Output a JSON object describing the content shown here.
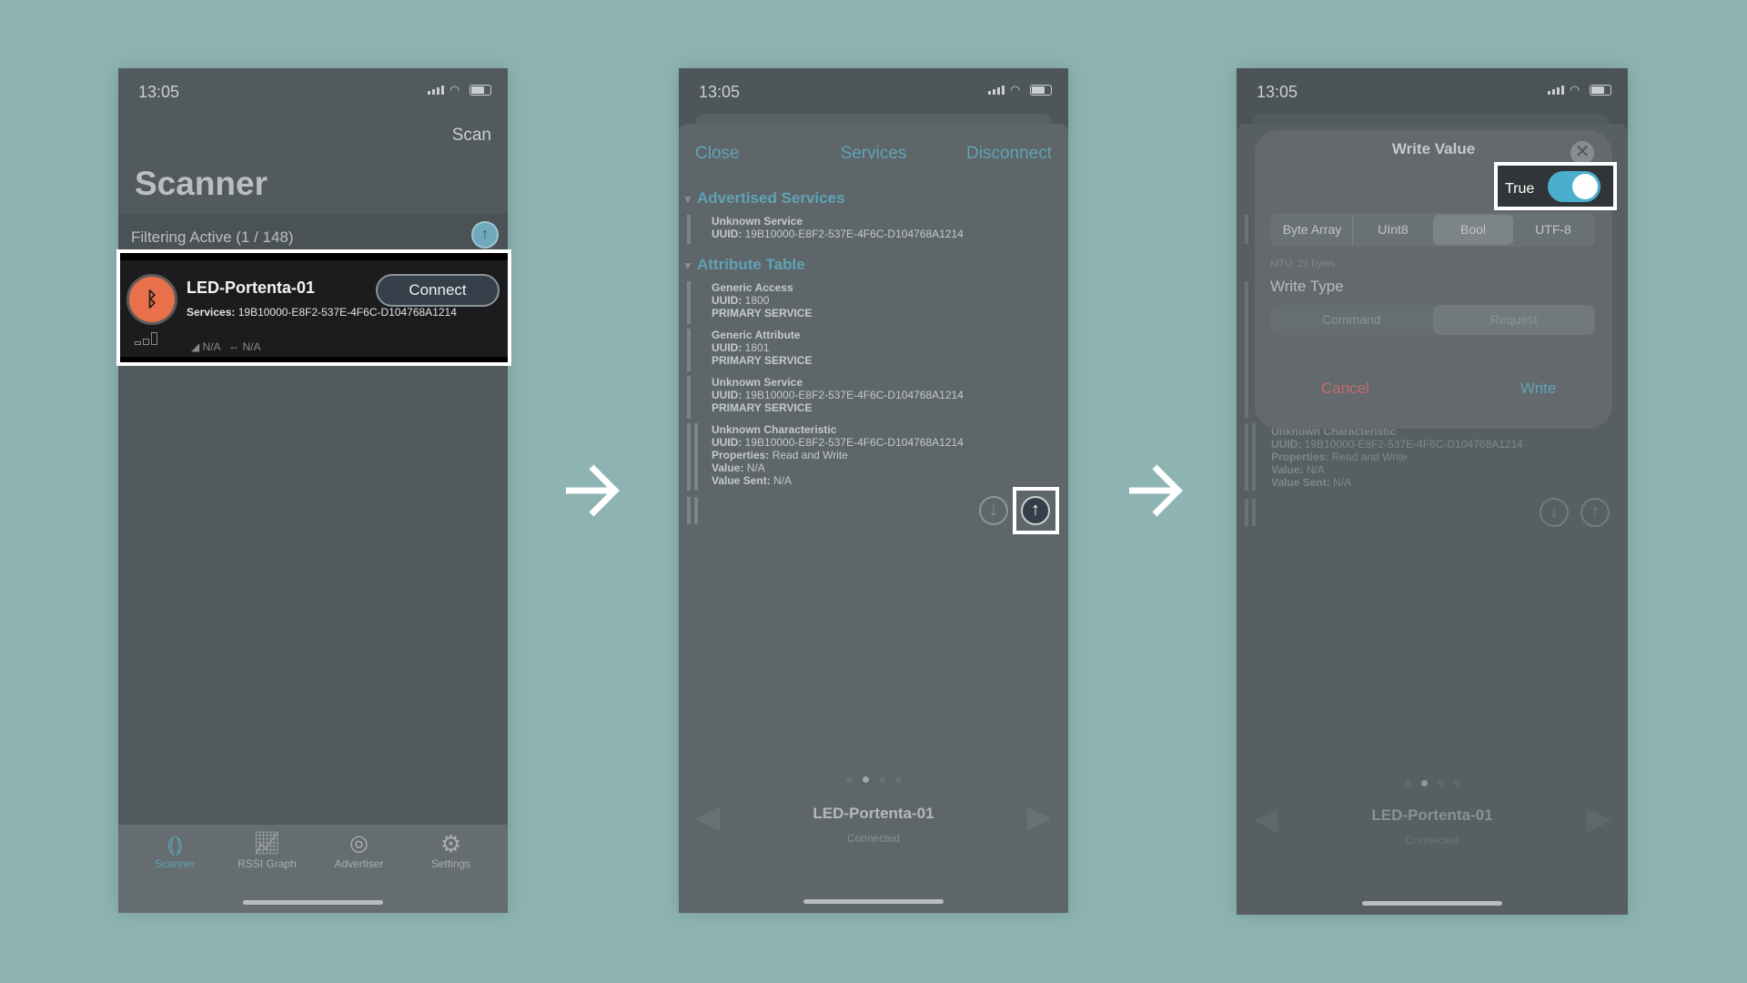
{
  "status": {
    "time": "13:05"
  },
  "screen1": {
    "nav_action": "Scan",
    "title": "Scanner",
    "filter_text": "Filtering Active (1 / 148)",
    "device": {
      "name": "LED-Portenta-01",
      "connect_label": "Connect",
      "services_label": "Services:",
      "services_value": "19B10000-E8F2-537E-4F6C-D104768A1214",
      "rssi": "N/A",
      "interval": "N/A"
    },
    "tabs": [
      {
        "label": "Scanner",
        "icon": "scanner-icon"
      },
      {
        "label": "RSSI Graph",
        "icon": "graph-icon"
      },
      {
        "label": "Advertiser",
        "icon": "advertiser-icon"
      },
      {
        "label": "Settings",
        "icon": "gear-icon"
      }
    ]
  },
  "screen2": {
    "close": "Close",
    "title": "Services",
    "disconnect": "Disconnect",
    "advertised_header": "Advertised Services",
    "advertised": [
      {
        "name": "Unknown Service",
        "uuid_label": "UUID:",
        "uuid": "19B10000-E8F2-537E-4F6C-D104768A1214"
      }
    ],
    "attribute_header": "Attribute Table",
    "attributes": [
      {
        "name": "Generic Access",
        "uuid_label": "UUID:",
        "uuid": "1800",
        "type": "PRIMARY SERVICE"
      },
      {
        "name": "Generic Attribute",
        "uuid_label": "UUID:",
        "uuid": "1801",
        "type": "PRIMARY SERVICE"
      },
      {
        "name": "Unknown Service",
        "uuid_label": "UUID:",
        "uuid": "19B10000-E8F2-537E-4F6C-D104768A1214",
        "type": "PRIMARY SERVICE"
      }
    ],
    "characteristic": {
      "name": "Unknown Characteristic",
      "uuid_label": "UUID:",
      "uuid": "19B10000-E8F2-537E-4F6C-D104768A1214",
      "props_label": "Properties:",
      "props": "Read and Write",
      "value_label": "Value:",
      "value": "N/A",
      "sent_label": "Value Sent:",
      "sent": "N/A"
    },
    "device_name": "LED-Portenta-01",
    "device_status": "Connected",
    "page_index": 1,
    "page_count": 4
  },
  "screen3": {
    "dialog_title": "Write Value",
    "toggle_label": "True",
    "toggle_on": true,
    "formats": [
      "Byte Array",
      "UInt8",
      "Bool",
      "UTF-8"
    ],
    "selected_format": "Bool",
    "mtu": "MTU: 23 bytes",
    "write_type_label": "Write Type",
    "write_types": [
      "Command",
      "Request"
    ],
    "selected_write_type": "Request",
    "cancel": "Cancel",
    "write": "Write"
  },
  "colors": {
    "accent": "#5fa3b7",
    "bluetooth": "#e8704a",
    "cancel": "#c46a6f",
    "background": "#8db4b3"
  }
}
